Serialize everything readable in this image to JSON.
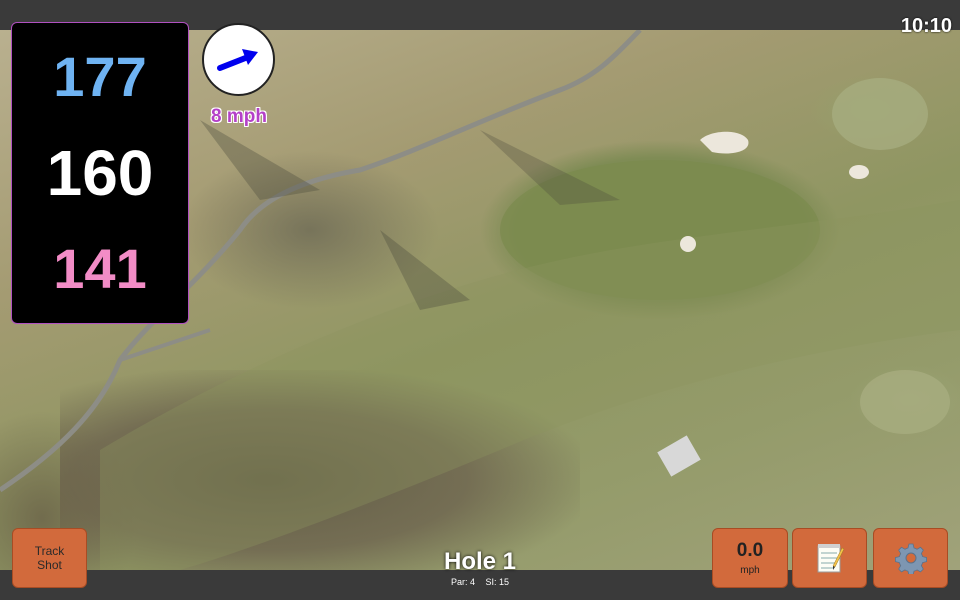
{
  "status_bar": {
    "time": "10:10"
  },
  "distances": {
    "back": "177",
    "middle": "160",
    "front": "141"
  },
  "wind": {
    "speed": "8 mph",
    "direction_icon": "arrow-icon",
    "arrow_color": "#0000ee"
  },
  "hole": {
    "title": "Hole 1",
    "par": "Par: 4",
    "si": "SI: 15"
  },
  "buttons": {
    "track_shot_line1": "Track",
    "track_shot_line2": "Shot",
    "speed_value": "0.0",
    "speed_unit": "mph",
    "notes_icon": "notepad-icon",
    "settings_icon": "gear-icon"
  },
  "colors": {
    "back_distance": "#6fb3f2",
    "middle_distance": "#ffffff",
    "front_distance": "#f28cc6",
    "button": "#d26a3c",
    "wind_text": "#b440c8"
  }
}
